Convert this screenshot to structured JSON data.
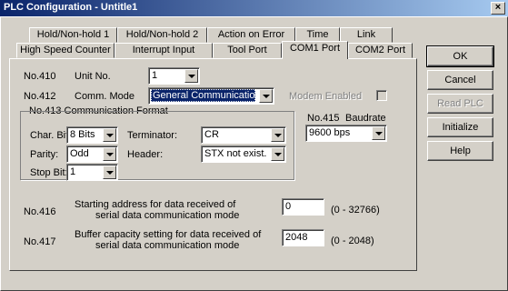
{
  "window": {
    "title": "PLC Configuration - Untitle1",
    "close_glyph": "×"
  },
  "tabs_back": [
    "Hold/Non-hold 1",
    "Hold/Non-hold 2",
    "Action on Error",
    "Time",
    "Link"
  ],
  "tabs_front": [
    "High Speed Counter",
    "Interrupt Input",
    "Tool Port",
    "COM1 Port",
    "COM2 Port"
  ],
  "active_tab": "COM1 Port",
  "unit_no": {
    "code": "No.410",
    "label": "Unit No.",
    "value": "1"
  },
  "comm_mode": {
    "code": "No.412",
    "label": "Comm. Mode",
    "value": "General Communication"
  },
  "modem": {
    "label": "Modem Enabled",
    "checked": false
  },
  "comm_format": {
    "title": "No.413 Communication Format",
    "char_bit": {
      "label": "Char. Bit:",
      "value": "8 Bits"
    },
    "terminator": {
      "label": "Terminator:",
      "value": "CR"
    },
    "parity": {
      "label": "Parity:",
      "value": "Odd"
    },
    "header": {
      "label": "Header:",
      "value": "STX not exist."
    },
    "stop_bit": {
      "label": "Stop Bit:",
      "value": "1"
    }
  },
  "baudrate": {
    "code": "No.415",
    "label": "Baudrate",
    "value": "9600 bps"
  },
  "start_addr": {
    "code": "No.416",
    "line1": "Starting address for data received of",
    "line2": "serial data communication mode",
    "value": "0",
    "range": "(0 - 32766)"
  },
  "buffer_cap": {
    "code": "No.417",
    "line1": "Buffer capacity setting for data received of",
    "line2": "serial data communication mode",
    "value": "2048",
    "range": "(0 - 2048)"
  },
  "buttons": {
    "ok": "OK",
    "cancel": "Cancel",
    "read_plc": "Read PLC",
    "initialize": "Initialize",
    "help": "Help"
  },
  "colors": {
    "titlebar_start": "#0a246a",
    "titlebar_end": "#a6caf0",
    "face": "#d4d0c8",
    "selection": "#0a246a"
  },
  "icons": {
    "dropdown": "chevron-down-icon",
    "close": "close-icon"
  }
}
